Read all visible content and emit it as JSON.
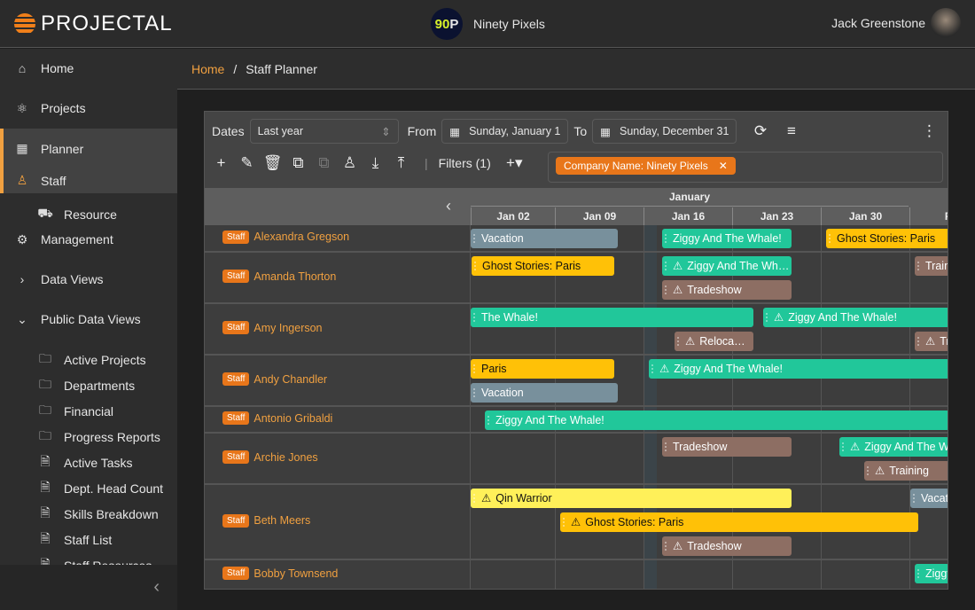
{
  "app": {
    "name": "Projectal",
    "org": "Ninety Pixels",
    "org_logo": "90P",
    "user": "Jack Greenstone"
  },
  "colors": {
    "accent": "#f0a040",
    "green": "#21c79a",
    "amber": "#ffc107",
    "yellow": "#fff059",
    "gray": "#78909c",
    "brown": "#8d6e63"
  },
  "sidebar": {
    "items": [
      {
        "label": "Home",
        "icon": "home-icon"
      },
      {
        "label": "Projects",
        "icon": "projects-icon"
      },
      {
        "label": "Planner",
        "icon": "calendar-icon"
      },
      {
        "label": "Staff",
        "icon": "worker-icon"
      },
      {
        "label": "Resource",
        "icon": "cart-icon"
      },
      {
        "label": "Management",
        "icon": "gears-icon"
      },
      {
        "label": "Data Views",
        "icon": "chevron-right-icon"
      },
      {
        "label": "Public Data Views",
        "icon": "chevron-down-icon"
      },
      {
        "label": "Active Projects",
        "icon": "folder-icon"
      },
      {
        "label": "Departments",
        "icon": "folder-icon"
      },
      {
        "label": "Financial",
        "icon": "folder-icon"
      },
      {
        "label": "Progress Reports",
        "icon": "folder-icon"
      },
      {
        "label": "Active Tasks",
        "icon": "doc-icon"
      },
      {
        "label": "Dept. Head Count",
        "icon": "doc-icon"
      },
      {
        "label": "Skills Breakdown",
        "icon": "doc-icon"
      },
      {
        "label": "Staff List",
        "icon": "doc-icon"
      },
      {
        "label": "Staff Resources",
        "icon": "doc-icon"
      }
    ]
  },
  "breadcrumb": {
    "home": "Home",
    "sep": "/",
    "current": "Staff Planner"
  },
  "toolbar": {
    "dates_label": "Dates",
    "dates_value": "Last year",
    "from_label": "From",
    "from_value": "Sunday, January 1",
    "to_label": "To",
    "to_value": "Sunday, December 31",
    "filters_label": "Filters (1)",
    "filter_chip": "Company Name: Ninety Pixels"
  },
  "timeline": {
    "month": "January",
    "weeks": [
      "Jan 02",
      "Jan 09",
      "Jan 16",
      "Jan 23",
      "Jan 30",
      "Feb"
    ]
  },
  "badge": "Staff",
  "staff": [
    {
      "name": "Alexandra Gregson",
      "bars": [
        {
          "label": "Vacation",
          "type": "gray"
        },
        {
          "label": "Ziggy And The Whale!",
          "type": "green"
        },
        {
          "label": "Ghost Stories: Paris",
          "type": "amber"
        }
      ]
    },
    {
      "name": "Amanda Thorton",
      "bars": [
        {
          "label": "Ghost Stories: Paris",
          "type": "amber"
        },
        {
          "label": "Ziggy And The Wh…",
          "type": "green",
          "warn": true
        },
        {
          "label": "Tradeshow",
          "type": "brown",
          "warn": true
        },
        {
          "label": "Train",
          "type": "brown"
        }
      ]
    },
    {
      "name": "Amy Ingerson",
      "bars": [
        {
          "label": "The Whale!",
          "type": "green"
        },
        {
          "label": "Ziggy And The Whale!",
          "type": "green",
          "warn": true
        },
        {
          "label": "Reloca…",
          "type": "brown",
          "warn": true
        },
        {
          "label": "Tr",
          "type": "brown",
          "warn": true
        }
      ]
    },
    {
      "name": "Andy Chandler",
      "bars": [
        {
          "label": "Paris",
          "type": "amber"
        },
        {
          "label": "Ziggy And The Whale!",
          "type": "green",
          "warn": true
        },
        {
          "label": "Vacation",
          "type": "gray"
        }
      ]
    },
    {
      "name": "Antonio Gribaldi",
      "bars": [
        {
          "label": "Ziggy And The Whale!",
          "type": "green"
        }
      ]
    },
    {
      "name": "Archie Jones",
      "bars": [
        {
          "label": "Tradeshow",
          "type": "brown"
        },
        {
          "label": "Ziggy And The Wh",
          "type": "green",
          "warn": true
        },
        {
          "label": "Training",
          "type": "brown",
          "warn": true
        }
      ]
    },
    {
      "name": "Beth Meers",
      "bars": [
        {
          "label": "Qin Warrior",
          "type": "yellow",
          "warn": true
        },
        {
          "label": "Vacat",
          "type": "gray"
        },
        {
          "label": "Ghost Stories: Paris",
          "type": "amber",
          "warn": true
        },
        {
          "label": "Tradeshow",
          "type": "brown",
          "warn": true
        }
      ]
    },
    {
      "name": "Bobby Townsend",
      "bars": [
        {
          "label": "Ziggy",
          "type": "green"
        }
      ]
    }
  ]
}
